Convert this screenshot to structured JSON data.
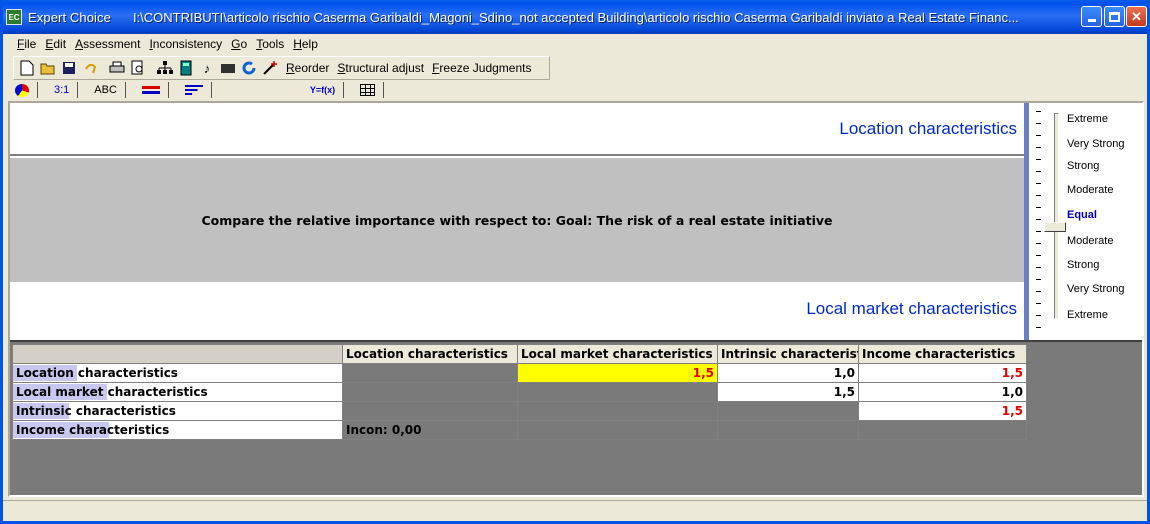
{
  "window": {
    "app_title": "Expert Choice",
    "file_path": "I:\\CONTRIBUTI\\articolo rischio Caserma Garibaldi_Magoni_Sdino_not accepted Building\\articolo rischio Caserma Garibaldi inviato a Real Estate Financ...",
    "icon_text": "EC"
  },
  "menu": [
    "File",
    "Edit",
    "Assessment",
    "Inconsistency",
    "Go",
    "Tools",
    "Help"
  ],
  "toolbar": {
    "icons": [
      "new-icon",
      "open-icon",
      "save-icon",
      "undo-icon",
      "print-icon",
      "print-preview-icon",
      "hierarchy-icon",
      "calculator-icon",
      "music-icon",
      "folder-icon",
      "refresh-icon",
      "magic-wand-icon"
    ],
    "reorder": "Reorder",
    "structural_adjust": "Structural adjust",
    "freeze": "Freeze Judgments"
  },
  "tabs": {
    "numerical": "3:1",
    "verbal": "ABC",
    "formula": "Y=f(x)"
  },
  "compare": {
    "top_element": "Location characteristics",
    "instruction": "Compare the relative importance  with respect to: Goal: The risk of a real estate initiative",
    "bottom_element": "Local market characteristics"
  },
  "scale": {
    "labels": [
      "Extreme",
      "Very Strong",
      "Strong",
      "Moderate",
      "Equal",
      "Moderate",
      "Strong",
      "Very Strong",
      "Extreme"
    ],
    "selected": "Equal"
  },
  "matrix": {
    "columns": [
      "Location characteristics",
      "Local market characteristics",
      "Intrinsic characteristi",
      "Income characteristics"
    ],
    "rows": [
      {
        "name": "Location characteristics",
        "cells": [
          "",
          "1,5",
          "1,0",
          "1,5"
        ]
      },
      {
        "name": "Local market characteristics",
        "cells": [
          "",
          "",
          "1,5",
          "1,0"
        ]
      },
      {
        "name": "Intrinsic characteristics",
        "cells": [
          "",
          "",
          "",
          "1,5"
        ]
      },
      {
        "name": "Income characteristics",
        "cells": [
          "Incon: 0,00",
          "",
          "",
          ""
        ]
      }
    ]
  },
  "colors": {
    "title_bar": "#0054e3",
    "element_text": "#0028c8",
    "selected_cell": "#ffff00",
    "inverse_value": "#e00000",
    "equal_label": "#0000c8"
  }
}
